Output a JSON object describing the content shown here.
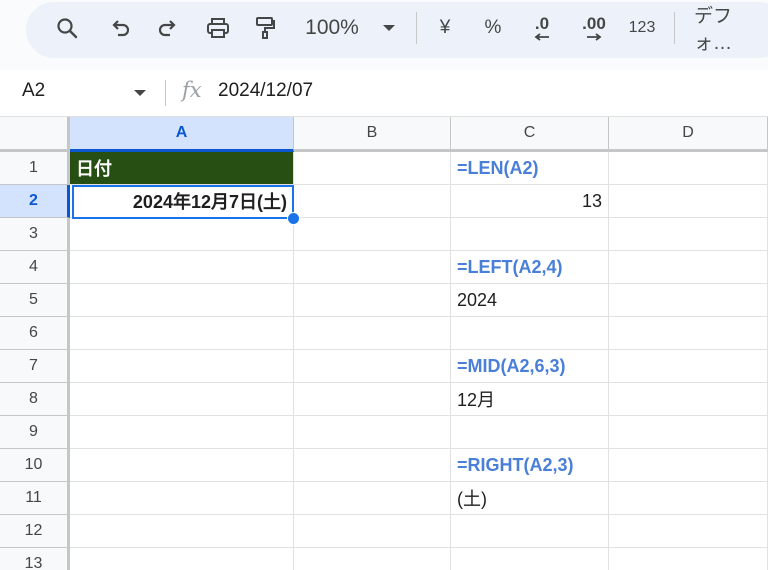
{
  "toolbar": {
    "zoom": "100%",
    "currency": "¥",
    "percent": "%",
    "dec_decrease": ".0",
    "dec_increase": ".00",
    "more_formats": "123",
    "font": "デフォ…"
  },
  "formula_bar": {
    "name_box": "A2",
    "fx": "fx",
    "value": "2024/12/07"
  },
  "columns": [
    "A",
    "B",
    "C",
    "D"
  ],
  "rows": [
    "1",
    "2",
    "3",
    "4",
    "5",
    "6",
    "7",
    "8",
    "9",
    "10",
    "11",
    "12",
    "13"
  ],
  "cells": {
    "A1": "日付",
    "A2": "2024年12月7日(土)",
    "C1": "=LEN(A2)",
    "C2": "13",
    "C4": "=LEFT(A2,4)",
    "C5": "2024",
    "C7": "=MID(A2,6,3)",
    "C8": "12月",
    "C10": "=RIGHT(A2,3)",
    "C11": "(土)"
  },
  "colors": {
    "header_fill": "#274e13",
    "formula_text": "#4a7fd9",
    "selection": "#1a73e8"
  }
}
